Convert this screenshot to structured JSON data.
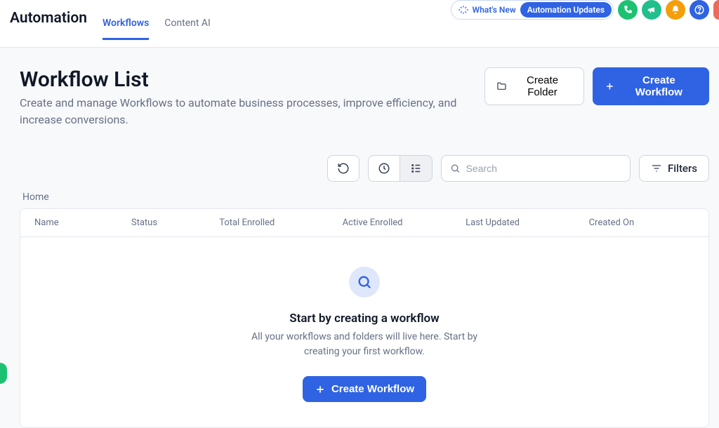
{
  "header": {
    "whats_new": "What's New",
    "updates_pill": "Automation Updates"
  },
  "nav": {
    "main": "Automation",
    "tabs": [
      "Workflows",
      "Content AI"
    ],
    "active_index": 0
  },
  "page": {
    "title": "Workflow List",
    "description": "Create and manage Workflows to automate business processes, improve efficiency, and increase conversions."
  },
  "actions": {
    "create_folder": "Create Folder",
    "create_workflow": "Create Workflow"
  },
  "toolbar": {
    "search_placeholder": "Search",
    "filters": "Filters"
  },
  "breadcrumb": "Home",
  "table": {
    "columns": [
      "Name",
      "Status",
      "Total Enrolled",
      "Active Enrolled",
      "Last Updated",
      "Created On"
    ]
  },
  "empty": {
    "title": "Start by creating a workflow",
    "description": "All your workflows and folders will live here. Start by creating your first workflow.",
    "cta": "Create Workflow"
  }
}
